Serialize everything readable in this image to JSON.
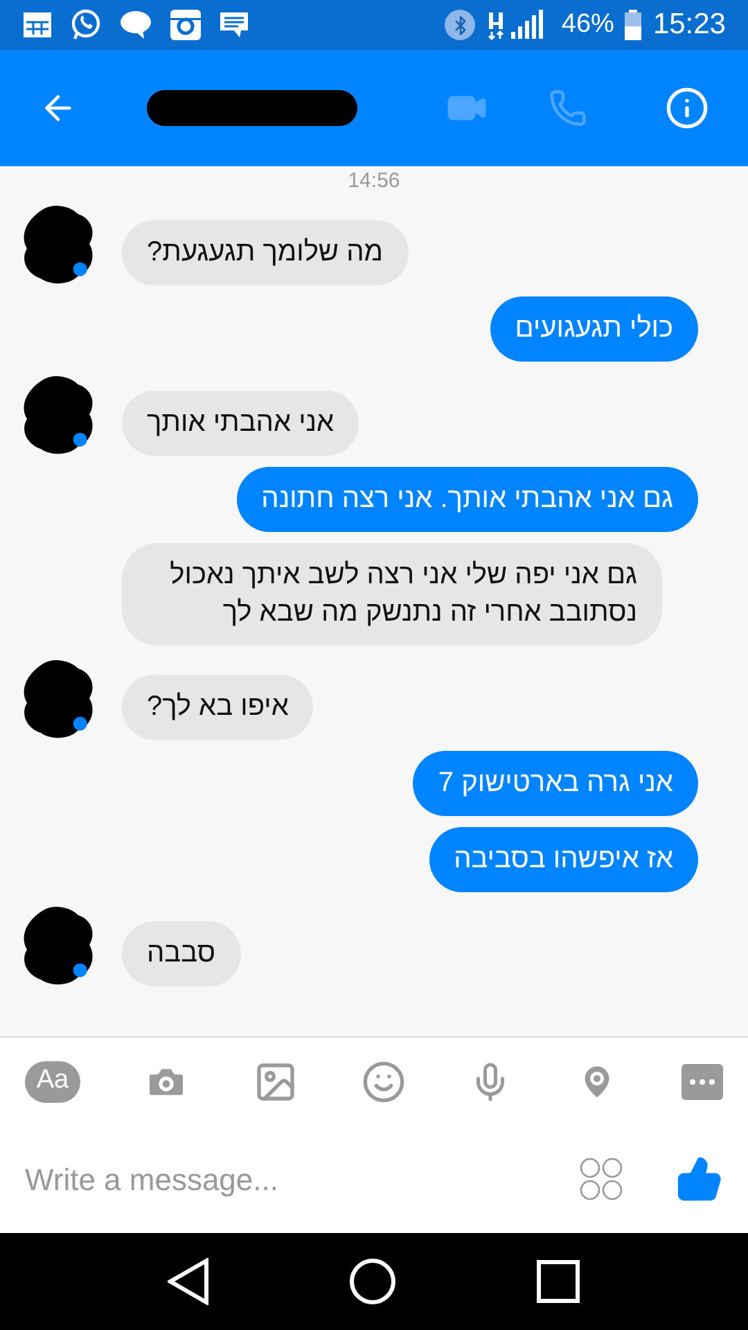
{
  "status_bar": {
    "battery": "46%",
    "time": "15:23"
  },
  "timestamp": "14:56",
  "messages": [
    {
      "kind": "received",
      "text": "מה שלומך תגעגעת?",
      "avatar": true
    },
    {
      "kind": "sent",
      "text": "כולי תגעגועים"
    },
    {
      "kind": "received",
      "text": "אני אהבתי אותך",
      "avatar": true
    },
    {
      "kind": "sent",
      "text": "גם אני אהבתי אותך. אני רצה חתונה"
    },
    {
      "kind": "received",
      "text": "גם אני יפה שלי אני רצה לשב איתך נאכול נסתובב אחרי זה נתנשק מה שבא לך",
      "avatar": false
    },
    {
      "kind": "received",
      "text": "איפו בא לך?",
      "avatar": true
    },
    {
      "kind": "sent",
      "text": "אני גרה בארטישוק 7"
    },
    {
      "kind": "sent",
      "text": "אז איפשהו בסביבה"
    },
    {
      "kind": "received",
      "text": "סבבה",
      "avatar": true
    }
  ],
  "composer": {
    "aa": "Aa",
    "placeholder": "Write a message..."
  }
}
